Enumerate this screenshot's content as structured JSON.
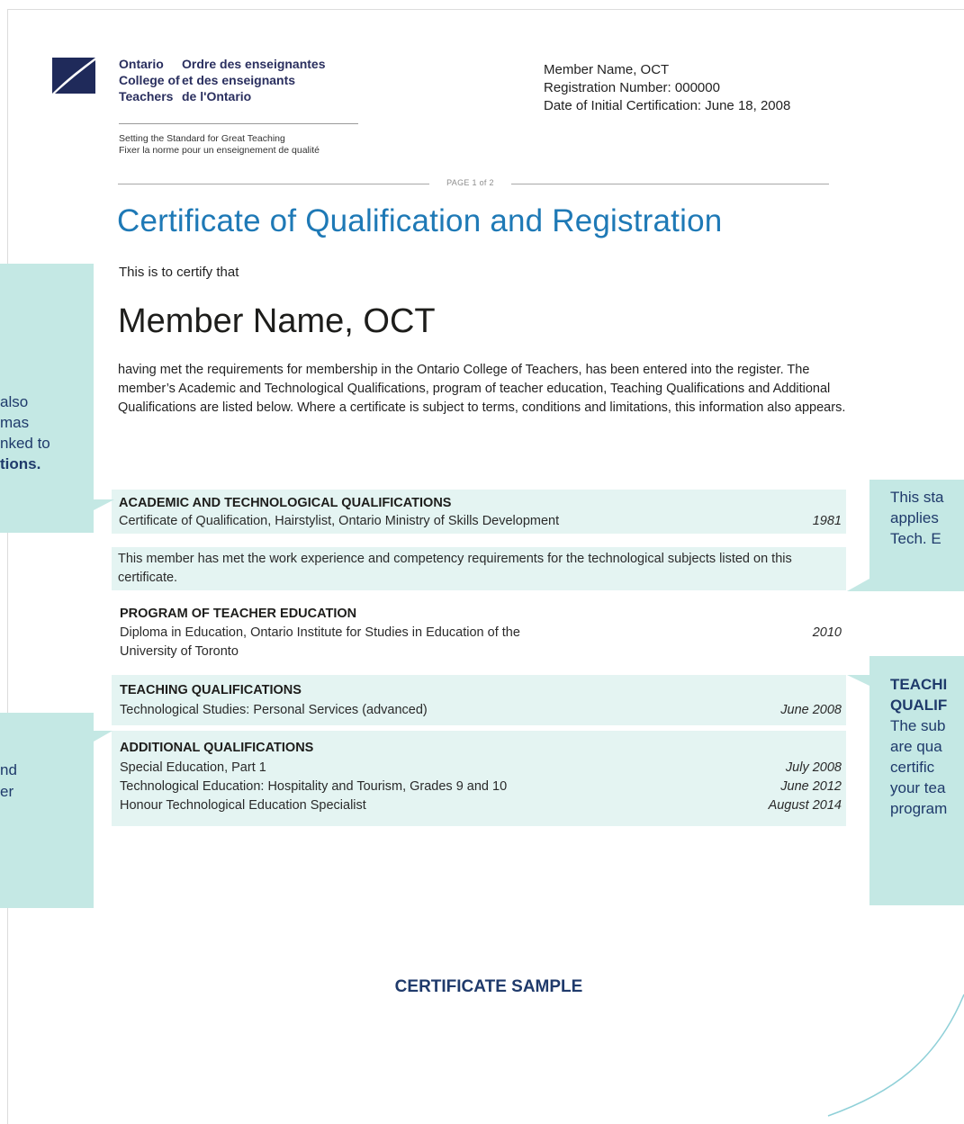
{
  "org": {
    "name_en": [
      "Ontario",
      "College of",
      "Teachers"
    ],
    "name_fr": [
      "Ordre des enseignantes",
      "et des enseignants",
      "de l'Ontario"
    ],
    "tagline_en": "Setting the Standard for Great Teaching",
    "tagline_fr": "Fixer la norme pour un enseignement de qualité"
  },
  "member_info": {
    "name": "Member Name, OCT",
    "registration": "Registration Number: 000000",
    "initial_cert": "Date of Initial Certification: June 18, 2008"
  },
  "page_label": "PAGE 1 of 2",
  "certificate": {
    "title": "Certificate of Qualification and Registration",
    "certify_line": "This is to certify that",
    "member_name": "Member Name, OCT",
    "intro": "having met the requirements for membership in the Ontario College of Teachers, has been entered into the register. The member’s Academic and Technological Qualifications, program of teacher education, Teaching Qualifications and Additional Qualifications are listed below. Where a certificate is subject to terms, conditions and limitations, this information also appears."
  },
  "sections": {
    "academic": {
      "heading": "ACADEMIC AND TECHNOLOGICAL QUALIFICATIONS",
      "entry": "Certificate of Qualification, Hairstylist, Ontario Ministry of Skills Development",
      "year": "1981"
    },
    "statement": "This member has met the work experience and competency requirements for the technological subjects listed on this certificate.",
    "program": {
      "heading": "PROGRAM OF TEACHER EDUCATION",
      "entry_line1": "Diploma in Education, Ontario Institute for Studies in Education of the",
      "entry_line2": "University of Toronto",
      "year": "2010"
    },
    "teaching": {
      "heading": "TEACHING QUALIFICATIONS",
      "entry": "Technological Studies: Personal Services (advanced)",
      "year": "June 2008"
    },
    "additional": {
      "heading": "ADDITIONAL QUALIFICATIONS",
      "entries": [
        {
          "label": "Special Education, Part 1",
          "date": "July 2008"
        },
        {
          "label": "Technological Education: Hospitality and Tourism, Grades 9 and 10",
          "date": "June 2012"
        },
        {
          "label": "Honour Technological Education Specialist",
          "date": "August 2014"
        }
      ]
    }
  },
  "callouts": {
    "left_top": [
      "",
      "also",
      "mas",
      "nked to",
      "tions."
    ],
    "left_bottom": [
      "nd",
      "er"
    ],
    "right_top": [
      "This sta",
      "applies",
      "Tech. E"
    ],
    "right_bottom_bold": [
      "TEACHI",
      "QUALIF"
    ],
    "right_bottom": [
      "The sub",
      "are qua",
      "certific",
      "your tea",
      "program"
    ]
  },
  "footer": {
    "sample_label": "CERTIFICATE SAMPLE"
  },
  "colors": {
    "title_blue": "#1e79b6",
    "navy": "#1f3a6b",
    "band": "#e4f4f2",
    "callout": "#c4e8e4"
  }
}
